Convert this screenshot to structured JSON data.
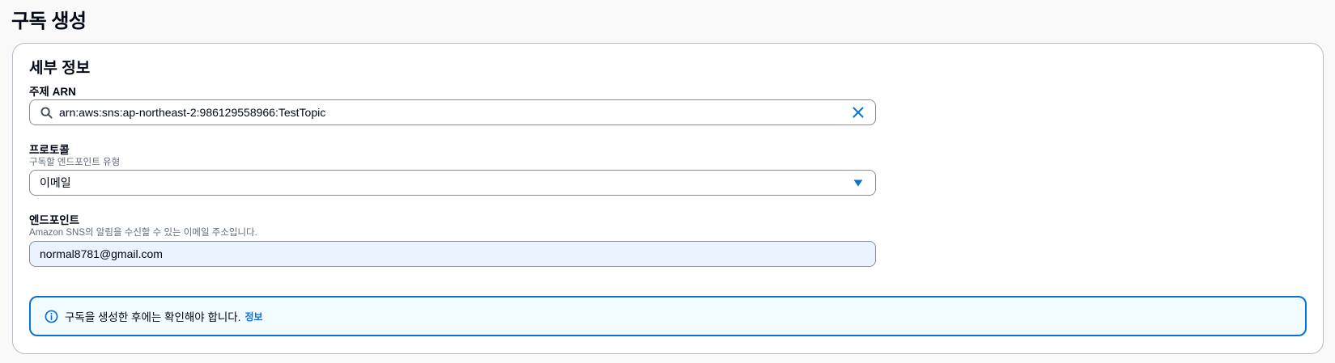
{
  "page": {
    "title": "구독 생성"
  },
  "details": {
    "section_title": "세부 정보",
    "topic_arn": {
      "label": "주제 ARN",
      "value": "arn:aws:sns:ap-northeast-2:986129558966:TestTopic",
      "search_icon": "search-icon",
      "clear_icon": "close-icon"
    },
    "protocol": {
      "label": "프로토콜",
      "description": "구독할 엔드포인트 유형",
      "selected": "이메일",
      "caret_icon": "caret-down-icon"
    },
    "endpoint": {
      "label": "엔드포인트",
      "description": "Amazon SNS의 알림을 수신할 수 있는 이메일 주소입니다.",
      "value": "normal8781@gmail.com"
    },
    "alert": {
      "icon": "info-icon",
      "message": "구독을 생성한 후에는 확인해야 합니다.",
      "link_label": "정보"
    }
  },
  "colors": {
    "accent": "#0972d3",
    "endpoint_bg": "#eaf3ff",
    "alert_bg": "#f2fbff"
  }
}
